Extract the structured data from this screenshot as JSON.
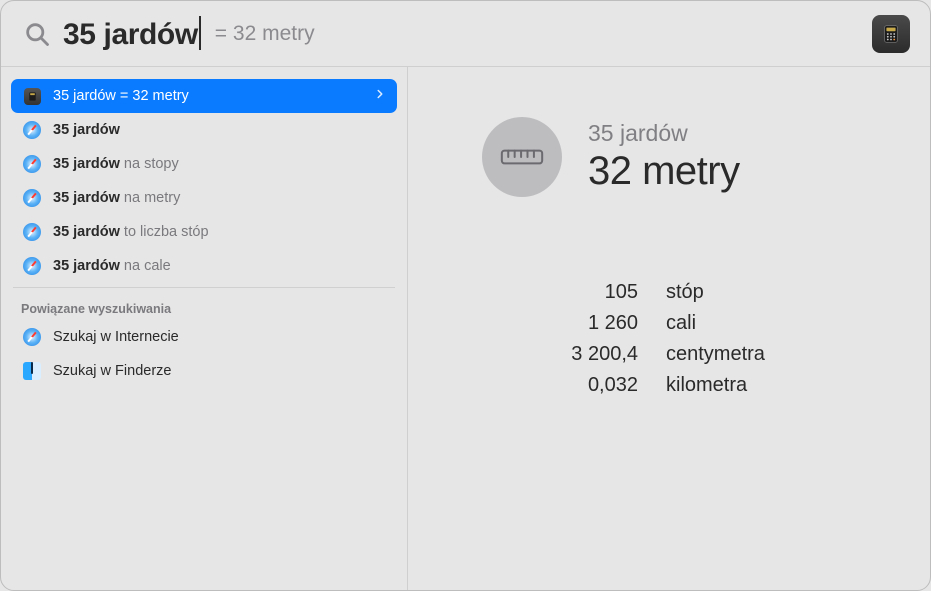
{
  "search": {
    "query": "35 jardów",
    "inline_result": "= 32 metry"
  },
  "results": {
    "top": {
      "label": "35 jardów = 32 metry"
    },
    "suggestions": [
      {
        "query": "35 jardów",
        "suffix": ""
      },
      {
        "query": "35 jardów",
        "suffix": " na stopy"
      },
      {
        "query": "35 jardów",
        "suffix": " na metry"
      },
      {
        "query": "35 jardów",
        "suffix": " to liczba stóp"
      },
      {
        "query": "35 jardów",
        "suffix": " na cale"
      }
    ],
    "related_header": "Powiązane wyszukiwania",
    "related": [
      {
        "label": "Szukaj w Internecie",
        "icon": "safari"
      },
      {
        "label": "Szukaj w Finderze",
        "icon": "finder"
      }
    ]
  },
  "detail": {
    "from": "35 jardów",
    "to": "32 metry",
    "conversions": [
      {
        "value": "105",
        "unit": "stóp"
      },
      {
        "value": "1 260",
        "unit": "cali"
      },
      {
        "value": "3 200,4",
        "unit": "centymetra"
      },
      {
        "value": "0,032",
        "unit": "kilometra"
      }
    ]
  }
}
